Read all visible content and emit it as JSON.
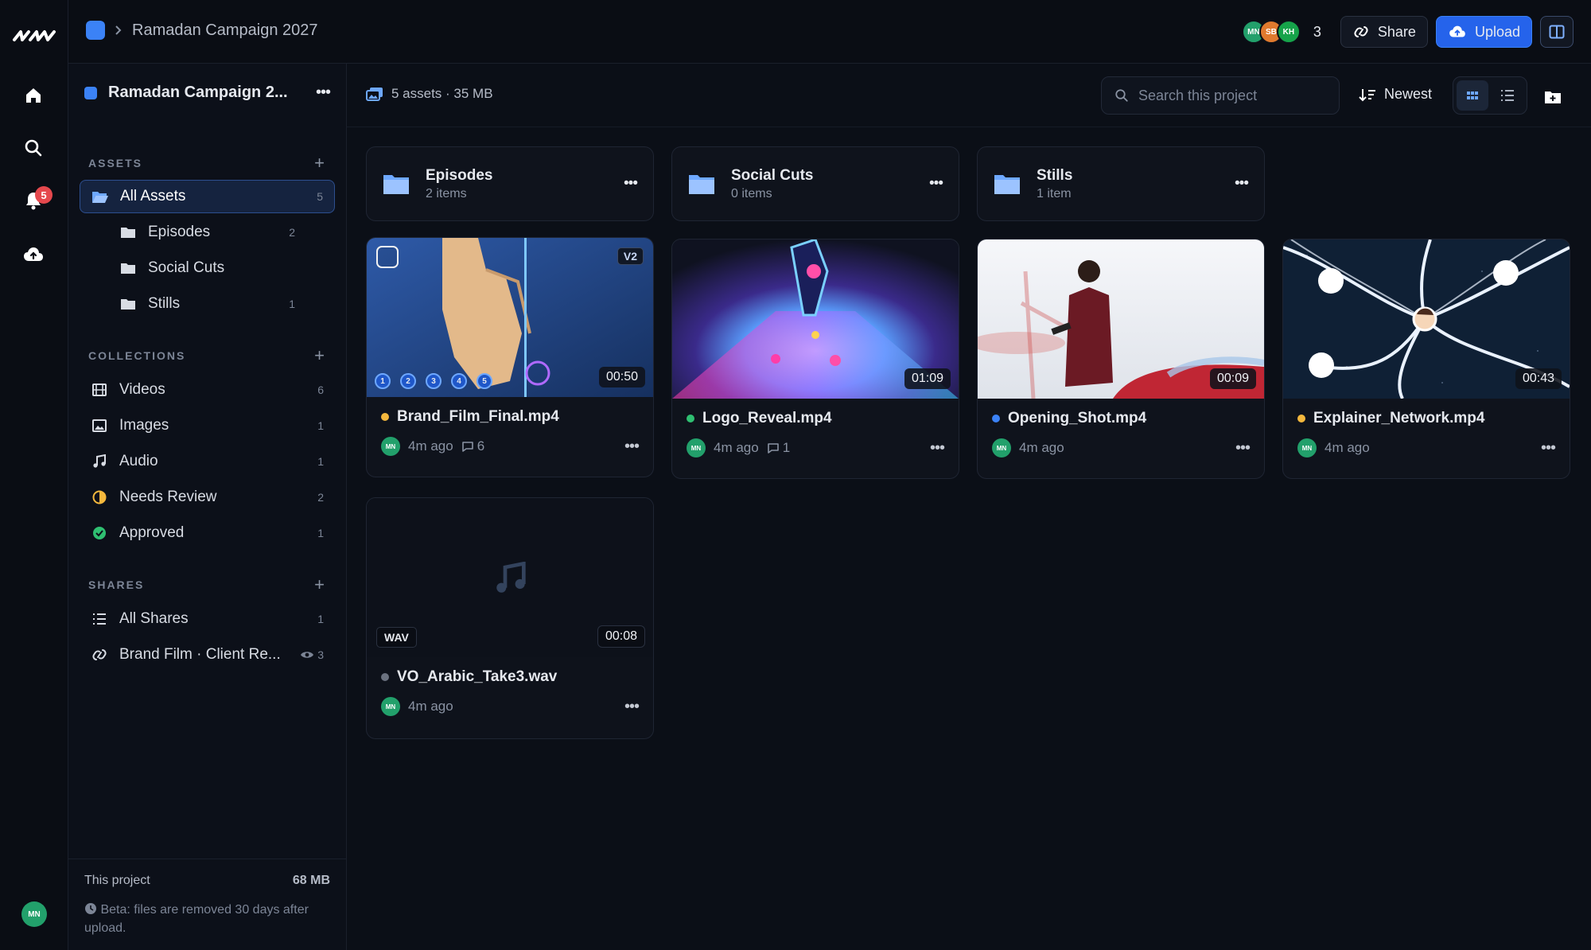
{
  "topbar": {
    "breadcrumb": "Ramadan Campaign 2027",
    "avatars": [
      {
        "initials": "MN",
        "color": "#22a06b"
      },
      {
        "initials": "SB",
        "color": "#e07a2e"
      },
      {
        "initials": "KH",
        "color": "#16a34a"
      }
    ],
    "avatar_count": "3",
    "share_label": "Share",
    "upload_label": "Upload"
  },
  "rail": {
    "notification_count": "5",
    "user_initials": "MN"
  },
  "sidebar": {
    "project_name": "Ramadan Campaign 2...",
    "assets_title": "ASSETS",
    "assets": [
      {
        "label": "All Assets",
        "count": "5"
      },
      {
        "label": "Episodes",
        "count": "2"
      },
      {
        "label": "Social Cuts",
        "count": ""
      },
      {
        "label": "Stills",
        "count": "1"
      }
    ],
    "collections_title": "COLLECTIONS",
    "collections": [
      {
        "label": "Videos",
        "count": "6"
      },
      {
        "label": "Images",
        "count": "1"
      },
      {
        "label": "Audio",
        "count": "1"
      },
      {
        "label": "Needs Review",
        "count": "2"
      },
      {
        "label": "Approved",
        "count": "1"
      }
    ],
    "shares_title": "SHARES",
    "shares": [
      {
        "label": "All Shares",
        "count": "1"
      },
      {
        "label": "Brand Film · Client Re...",
        "count": "3"
      }
    ],
    "footer": {
      "label": "This project",
      "size": "68 MB",
      "note": "Beta: files are removed 30 days after upload."
    }
  },
  "toolbar": {
    "summary": "5 assets · 35 MB",
    "search_placeholder": "Search this project",
    "sort_label": "Newest"
  },
  "folders": [
    {
      "name": "Episodes",
      "count": "2 items"
    },
    {
      "name": "Social Cuts",
      "count": "0 items"
    },
    {
      "name": "Stills",
      "count": "1 item"
    }
  ],
  "assets": [
    {
      "name": "Brand_Film_Final.mp4",
      "duration": "00:50",
      "time": "4m ago",
      "comments": "6",
      "status_color": "#f5b83d",
      "version": "V2"
    },
    {
      "name": "Logo_Reveal.mp4",
      "duration": "01:09",
      "time": "4m ago",
      "comments": "1",
      "status_color": "#2fbf71"
    },
    {
      "name": "Opening_Shot.mp4",
      "duration": "00:09",
      "time": "4m ago",
      "status_color": "#3b82f6"
    },
    {
      "name": "Explainer_Network.mp4",
      "duration": "00:43",
      "time": "4m ago",
      "status_color": "#f5b83d"
    },
    {
      "name": "VO_Arabic_Take3.wav",
      "duration": "00:08",
      "time": "4m ago",
      "status_color": "#6b7280",
      "type": "WAV"
    }
  ],
  "steps": [
    "1",
    "2",
    "3",
    "4",
    "5"
  ]
}
